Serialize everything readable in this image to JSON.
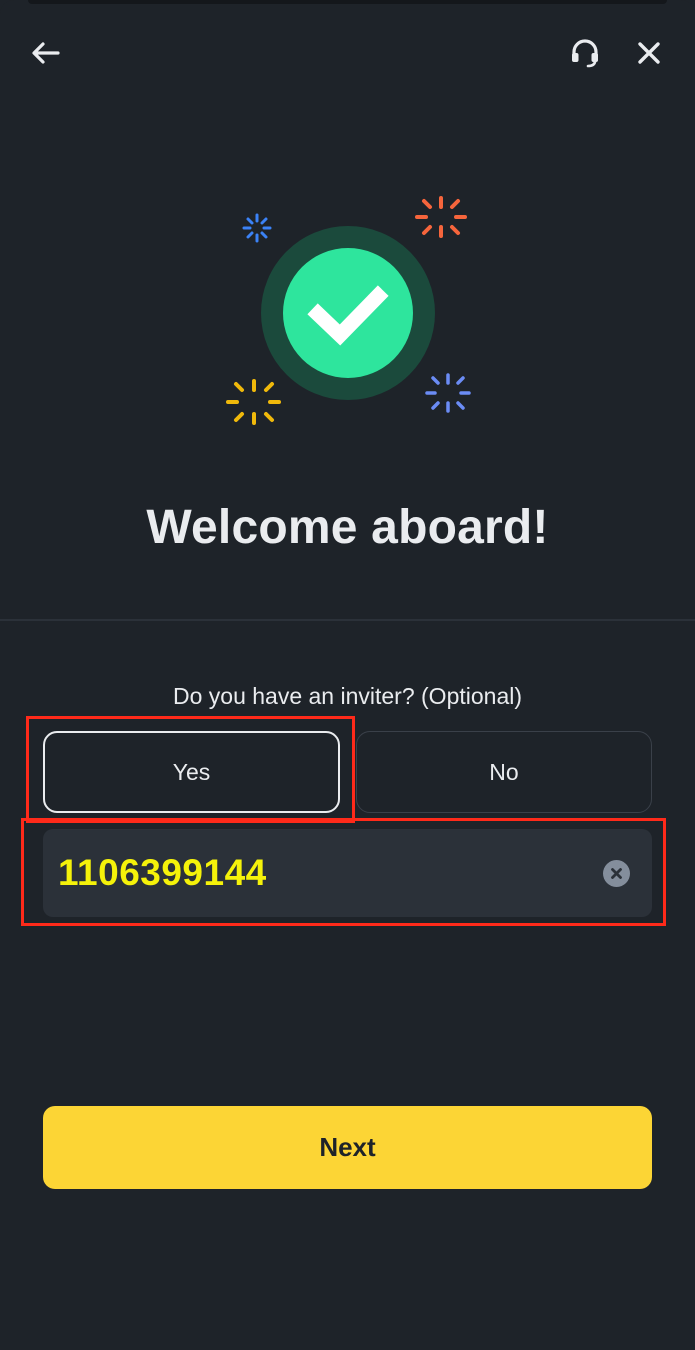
{
  "header": {
    "back_icon": "arrow-left-icon",
    "support_icon": "headset-icon",
    "close_icon": "close-icon"
  },
  "hero": {
    "icon": "check-circle-icon",
    "accent_color": "#2ee59d",
    "sparkle_colors": [
      "#3b82f6",
      "#f6653c",
      "#f0b90b",
      "#6b8cf5"
    ]
  },
  "title": "Welcome aboard!",
  "inviter": {
    "question": "Do you have an inviter? (Optional)",
    "options": [
      "Yes",
      "No"
    ],
    "selected": "Yes",
    "code_value": "1106399144",
    "clear_icon": "clear-circle-icon"
  },
  "next_label": "Next",
  "colors": {
    "background": "#1e2329",
    "primary": "#fcd535",
    "highlight": "#ff2a1a",
    "input_bg": "#2b3139"
  }
}
